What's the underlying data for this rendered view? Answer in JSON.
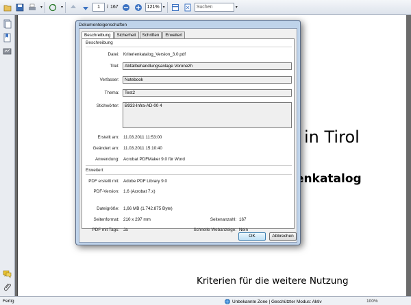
{
  "toolbar": {
    "page_current": "1",
    "page_separator": "/",
    "page_total": "167",
    "zoom": "121%",
    "search_placeholder": "Suchen"
  },
  "document": {
    "line1": "in Tirol",
    "line2": "enkatalog",
    "line3": "Kriterien für die weitere Nutzung"
  },
  "statusbar": {
    "left": "Fertig",
    "zone": "Unbekannte Zone | Geschützter Modus: Aktiv",
    "zoom": "100%"
  },
  "dialog": {
    "title": "Dokumenteigenschaften",
    "tabs": [
      "Beschreibung",
      "Sicherheit",
      "Schriften",
      "Erweitert"
    ],
    "description": {
      "heading": "Beschreibung",
      "file_label": "Datei:",
      "file": "Kriterienkatalog_Version_3.0.pdf",
      "title_label": "Titel:",
      "title": "Abfallbehandlungsanlage Voronezh",
      "author_label": "Verfasser:",
      "author": "Notebook",
      "subject_label": "Thema:",
      "subject": "Test2",
      "keywords_label": "Stichwörter:",
      "keywords": "B933-Infra-AD-00 4",
      "created_label": "Erstellt am:",
      "created": "11.03.2011 11:53:00",
      "modified_label": "Geändert am:",
      "modified": "11.03.2011 15:10:40",
      "app_label": "Anwendung:",
      "app": "Acrobat PDFMaker 9.0 für Word"
    },
    "advanced": {
      "heading": "Erweitert",
      "producer_label": "PDF erstellt mit:",
      "producer": "Adobe PDF Library 9.0",
      "version_label": "PDF-Version:",
      "version": "1.6 (Acrobat 7.x)",
      "size_label": "Dateigröße:",
      "size": "1,66 MB (1.742.875 Byte)",
      "format_label": "Seitenformat:",
      "format": "210 x 297 mm",
      "pages_label": "Seitenanzahl:",
      "pages": "167",
      "tagged_label": "PDF mit Tags:",
      "tagged": "Ja",
      "fastweb_label": "Schnelle Webanzeige:",
      "fastweb": "Nein"
    },
    "ok_label": "OK",
    "cancel_label": "Abbrechen"
  }
}
